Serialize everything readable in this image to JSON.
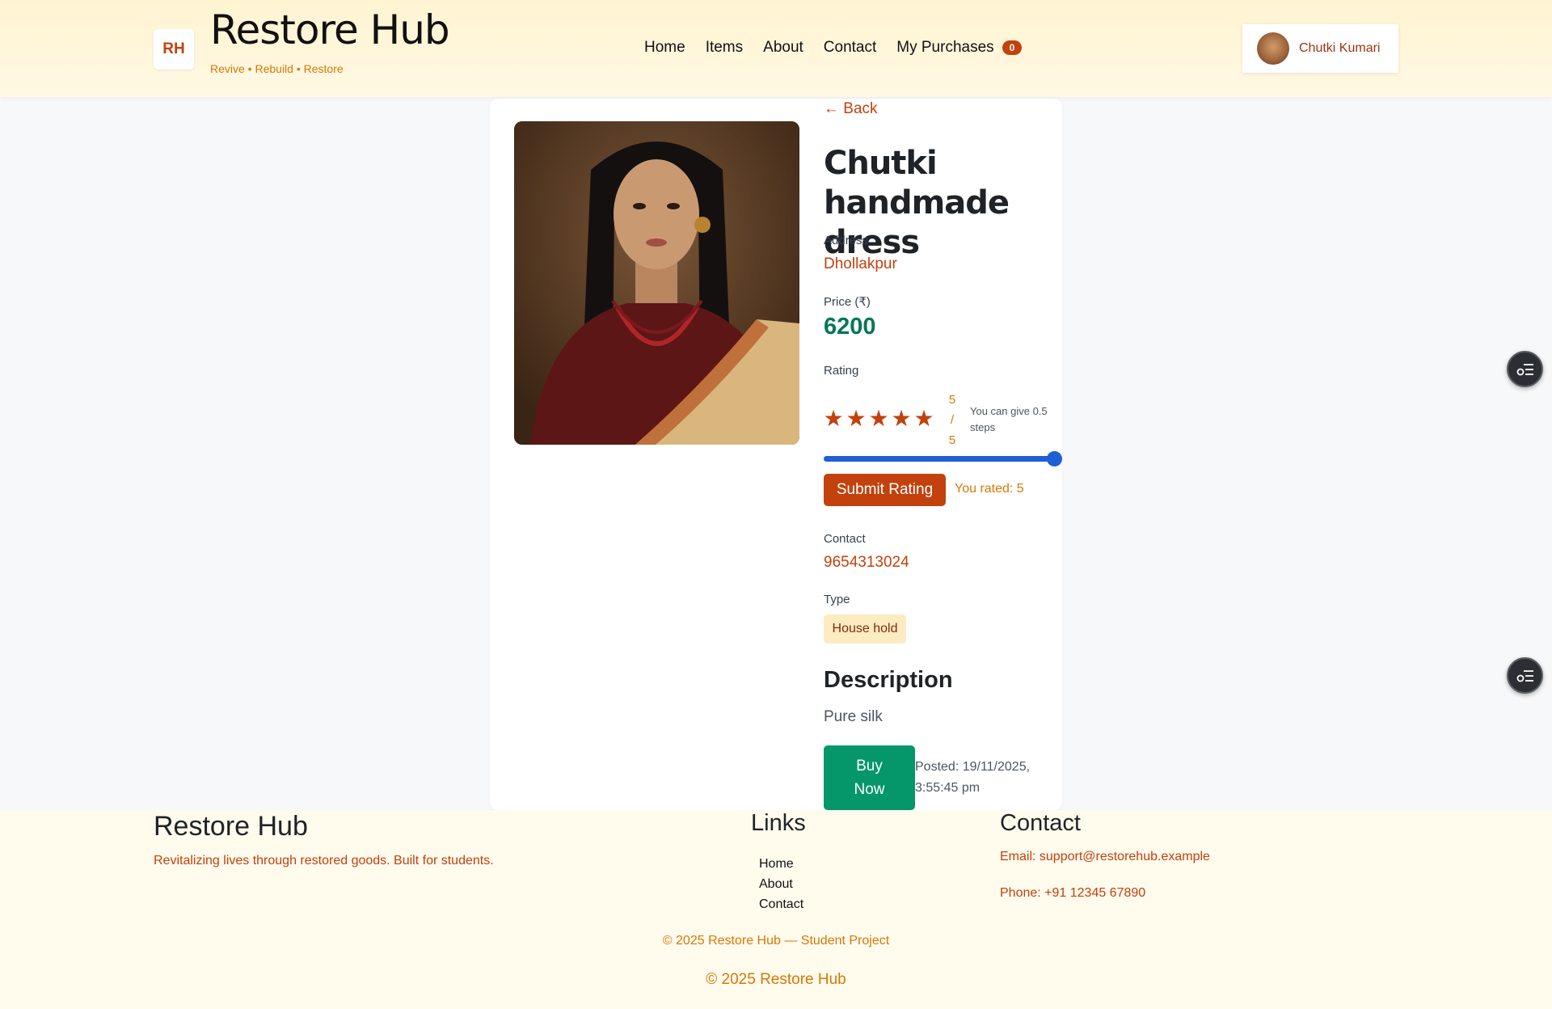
{
  "header": {
    "logo_text": "RH",
    "title": "Restore Hub",
    "tagline": "Revive • Rebuild • Restore",
    "nav": [
      {
        "label": "Home"
      },
      {
        "label": "Items"
      },
      {
        "label": "About"
      },
      {
        "label": "Contact"
      },
      {
        "label": "My Purchases"
      }
    ],
    "purchases_count": "0",
    "user_name": "Chutki Kumari"
  },
  "item": {
    "back_label": "Back",
    "title": "Chutki handmade dress",
    "address_label": "Address",
    "address": "Dhollakpur",
    "price_label": "Price (₹)",
    "price": "6200",
    "rating_label": "Rating",
    "stars": 5,
    "rating_value": "5",
    "rating_sep": "/",
    "rating_max": "5",
    "rating_hint": "You can give 0.5 steps",
    "slider_value": 5,
    "slider_max": 5,
    "submit_label": "Submit Rating",
    "rated_text": "You rated: 5",
    "contact_label": "Contact",
    "contact": "9654313024",
    "type_label": "Type",
    "type": "House hold",
    "description_heading": "Description",
    "description": "Pure silk",
    "buy_label": "Buy Now",
    "posted": "Posted: 19/11/2025, 3:55:45 pm"
  },
  "footer": {
    "brand": "Restore Hub",
    "tagline": "Revitalizing lives through restored goods. Built for students.",
    "links_heading": "Links",
    "links": [
      {
        "label": "Home"
      },
      {
        "label": "About"
      },
      {
        "label": "Contact"
      }
    ],
    "contact_heading": "Contact",
    "email": "Email: support@restorehub.example",
    "phone": "Phone: +91 12345 67890",
    "copyright_1": "© 2025 Restore Hub — Student Project",
    "copyright_2": "© 2025 Restore Hub"
  },
  "colors": {
    "accent": "#c2410c",
    "price": "#047857",
    "buy": "#059669",
    "slider": "#1e5fd6"
  }
}
